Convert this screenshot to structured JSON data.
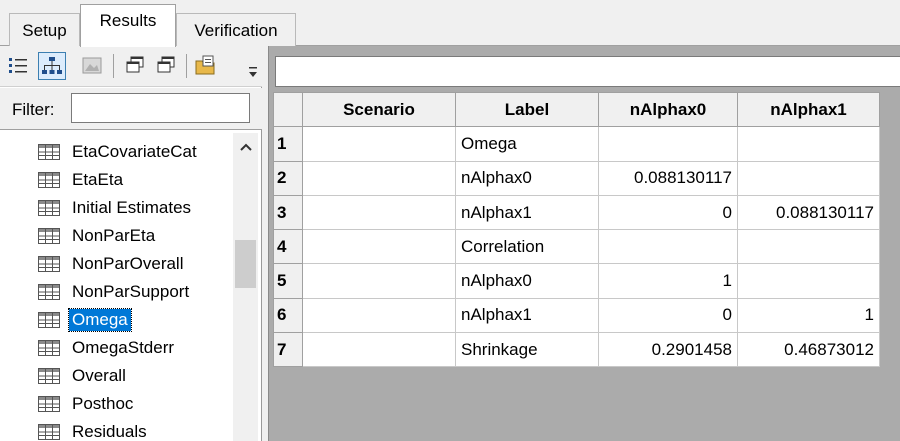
{
  "tabs": [
    {
      "label": "Setup",
      "active": false
    },
    {
      "label": "Results",
      "active": true
    },
    {
      "label": "Verification",
      "active": false
    }
  ],
  "toolbar": {
    "buttons": [
      {
        "icon": "list-view-icon"
      },
      {
        "icon": "tree-view-icon",
        "pressed": true
      },
      {
        "icon": "image-view-icon"
      },
      {
        "icon": "window-copy-icon"
      },
      {
        "icon": "window-copy-2-icon"
      },
      {
        "icon": "export-folder-icon"
      }
    ],
    "menu_icon": "toolbar-dropdown-icon"
  },
  "filter": {
    "label": "Filter:",
    "value": ""
  },
  "tree": {
    "items": [
      {
        "label": "EtaCovariateCat"
      },
      {
        "label": "EtaEta"
      },
      {
        "label": "Initial Estimates"
      },
      {
        "label": "NonParEta"
      },
      {
        "label": "NonParOverall"
      },
      {
        "label": "NonParSupport"
      },
      {
        "label": "Omega",
        "selected": true
      },
      {
        "label": "OmegaStderr"
      },
      {
        "label": "Overall"
      },
      {
        "label": "Posthoc"
      },
      {
        "label": "Residuals"
      }
    ]
  },
  "grid": {
    "columns": [
      "Scenario",
      "Label",
      "nAlphax0",
      "nAlphax1"
    ],
    "rows": [
      {
        "num": "1",
        "scenario": "",
        "label": "Omega",
        "a0": "",
        "a1": ""
      },
      {
        "num": "2",
        "scenario": "",
        "label": "nAlphax0",
        "a0": "0.088130117",
        "a1": ""
      },
      {
        "num": "3",
        "scenario": "",
        "label": "nAlphax1",
        "a0": "0",
        "a1": "0.088130117"
      },
      {
        "num": "4",
        "scenario": "",
        "label": "Correlation",
        "a0": "",
        "a1": ""
      },
      {
        "num": "5",
        "scenario": "",
        "label": "nAlphax0",
        "a0": "1",
        "a1": ""
      },
      {
        "num": "6",
        "scenario": "",
        "label": "nAlphax1",
        "a0": "0",
        "a1": "1"
      },
      {
        "num": "7",
        "scenario": "",
        "label": "Shrinkage",
        "a0": "0.2901458",
        "a1": "0.46873012"
      }
    ]
  },
  "colors": {
    "selection": "#0078d7",
    "grid_bg": "#ababab",
    "panel": "#f0f0f0"
  }
}
